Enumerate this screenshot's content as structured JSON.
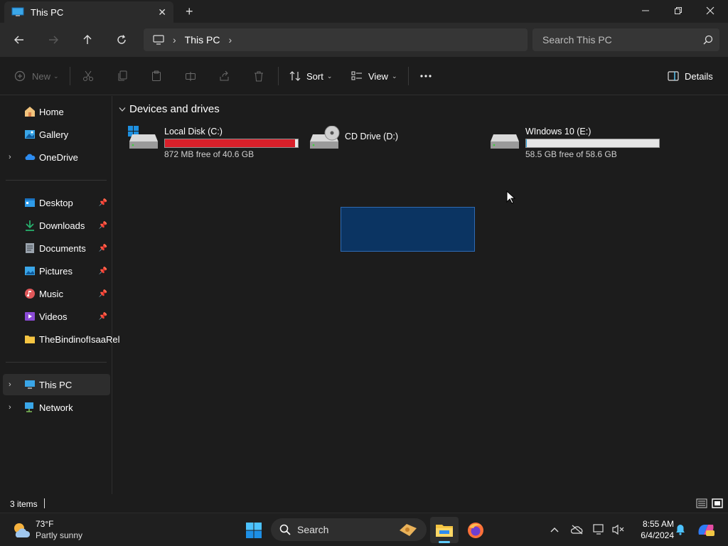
{
  "tab": {
    "title": "This PC"
  },
  "address": {
    "crumb": "This PC"
  },
  "search": {
    "placeholder": "Search This PC"
  },
  "toolbar": {
    "new_label": "New",
    "sort_label": "Sort",
    "view_label": "View",
    "details_label": "Details"
  },
  "sidebar": {
    "items": [
      {
        "label": "Home"
      },
      {
        "label": "Gallery"
      },
      {
        "label": "OneDrive"
      },
      {
        "label": "Desktop"
      },
      {
        "label": "Downloads"
      },
      {
        "label": "Documents"
      },
      {
        "label": "Pictures"
      },
      {
        "label": "Music"
      },
      {
        "label": "Videos"
      },
      {
        "label": "TheBindinofIsaaRel"
      },
      {
        "label": "This PC"
      },
      {
        "label": "Network"
      }
    ]
  },
  "content": {
    "group_title": "Devices and drives",
    "drives": [
      {
        "name": "Local Disk (C:)",
        "free_text": "872 MB free of 40.6 GB",
        "used_fraction": 0.979,
        "bar_color": "#d8202a"
      },
      {
        "name": "CD Drive (D:)"
      },
      {
        "name": "WIndows 10 (E:)",
        "free_text": "58.5 GB free of 58.6 GB",
        "used_fraction": 0.002,
        "bar_color": "#26a0da"
      }
    ]
  },
  "status": {
    "item_count": "3 items"
  },
  "taskbar": {
    "weather_temp": "73°F",
    "weather_desc": "Partly sunny",
    "search_placeholder": "Search",
    "time": "8:55 AM",
    "date": "6/4/2024"
  },
  "colors": {
    "accent": "#0078d4",
    "selection": "#0b3462"
  }
}
